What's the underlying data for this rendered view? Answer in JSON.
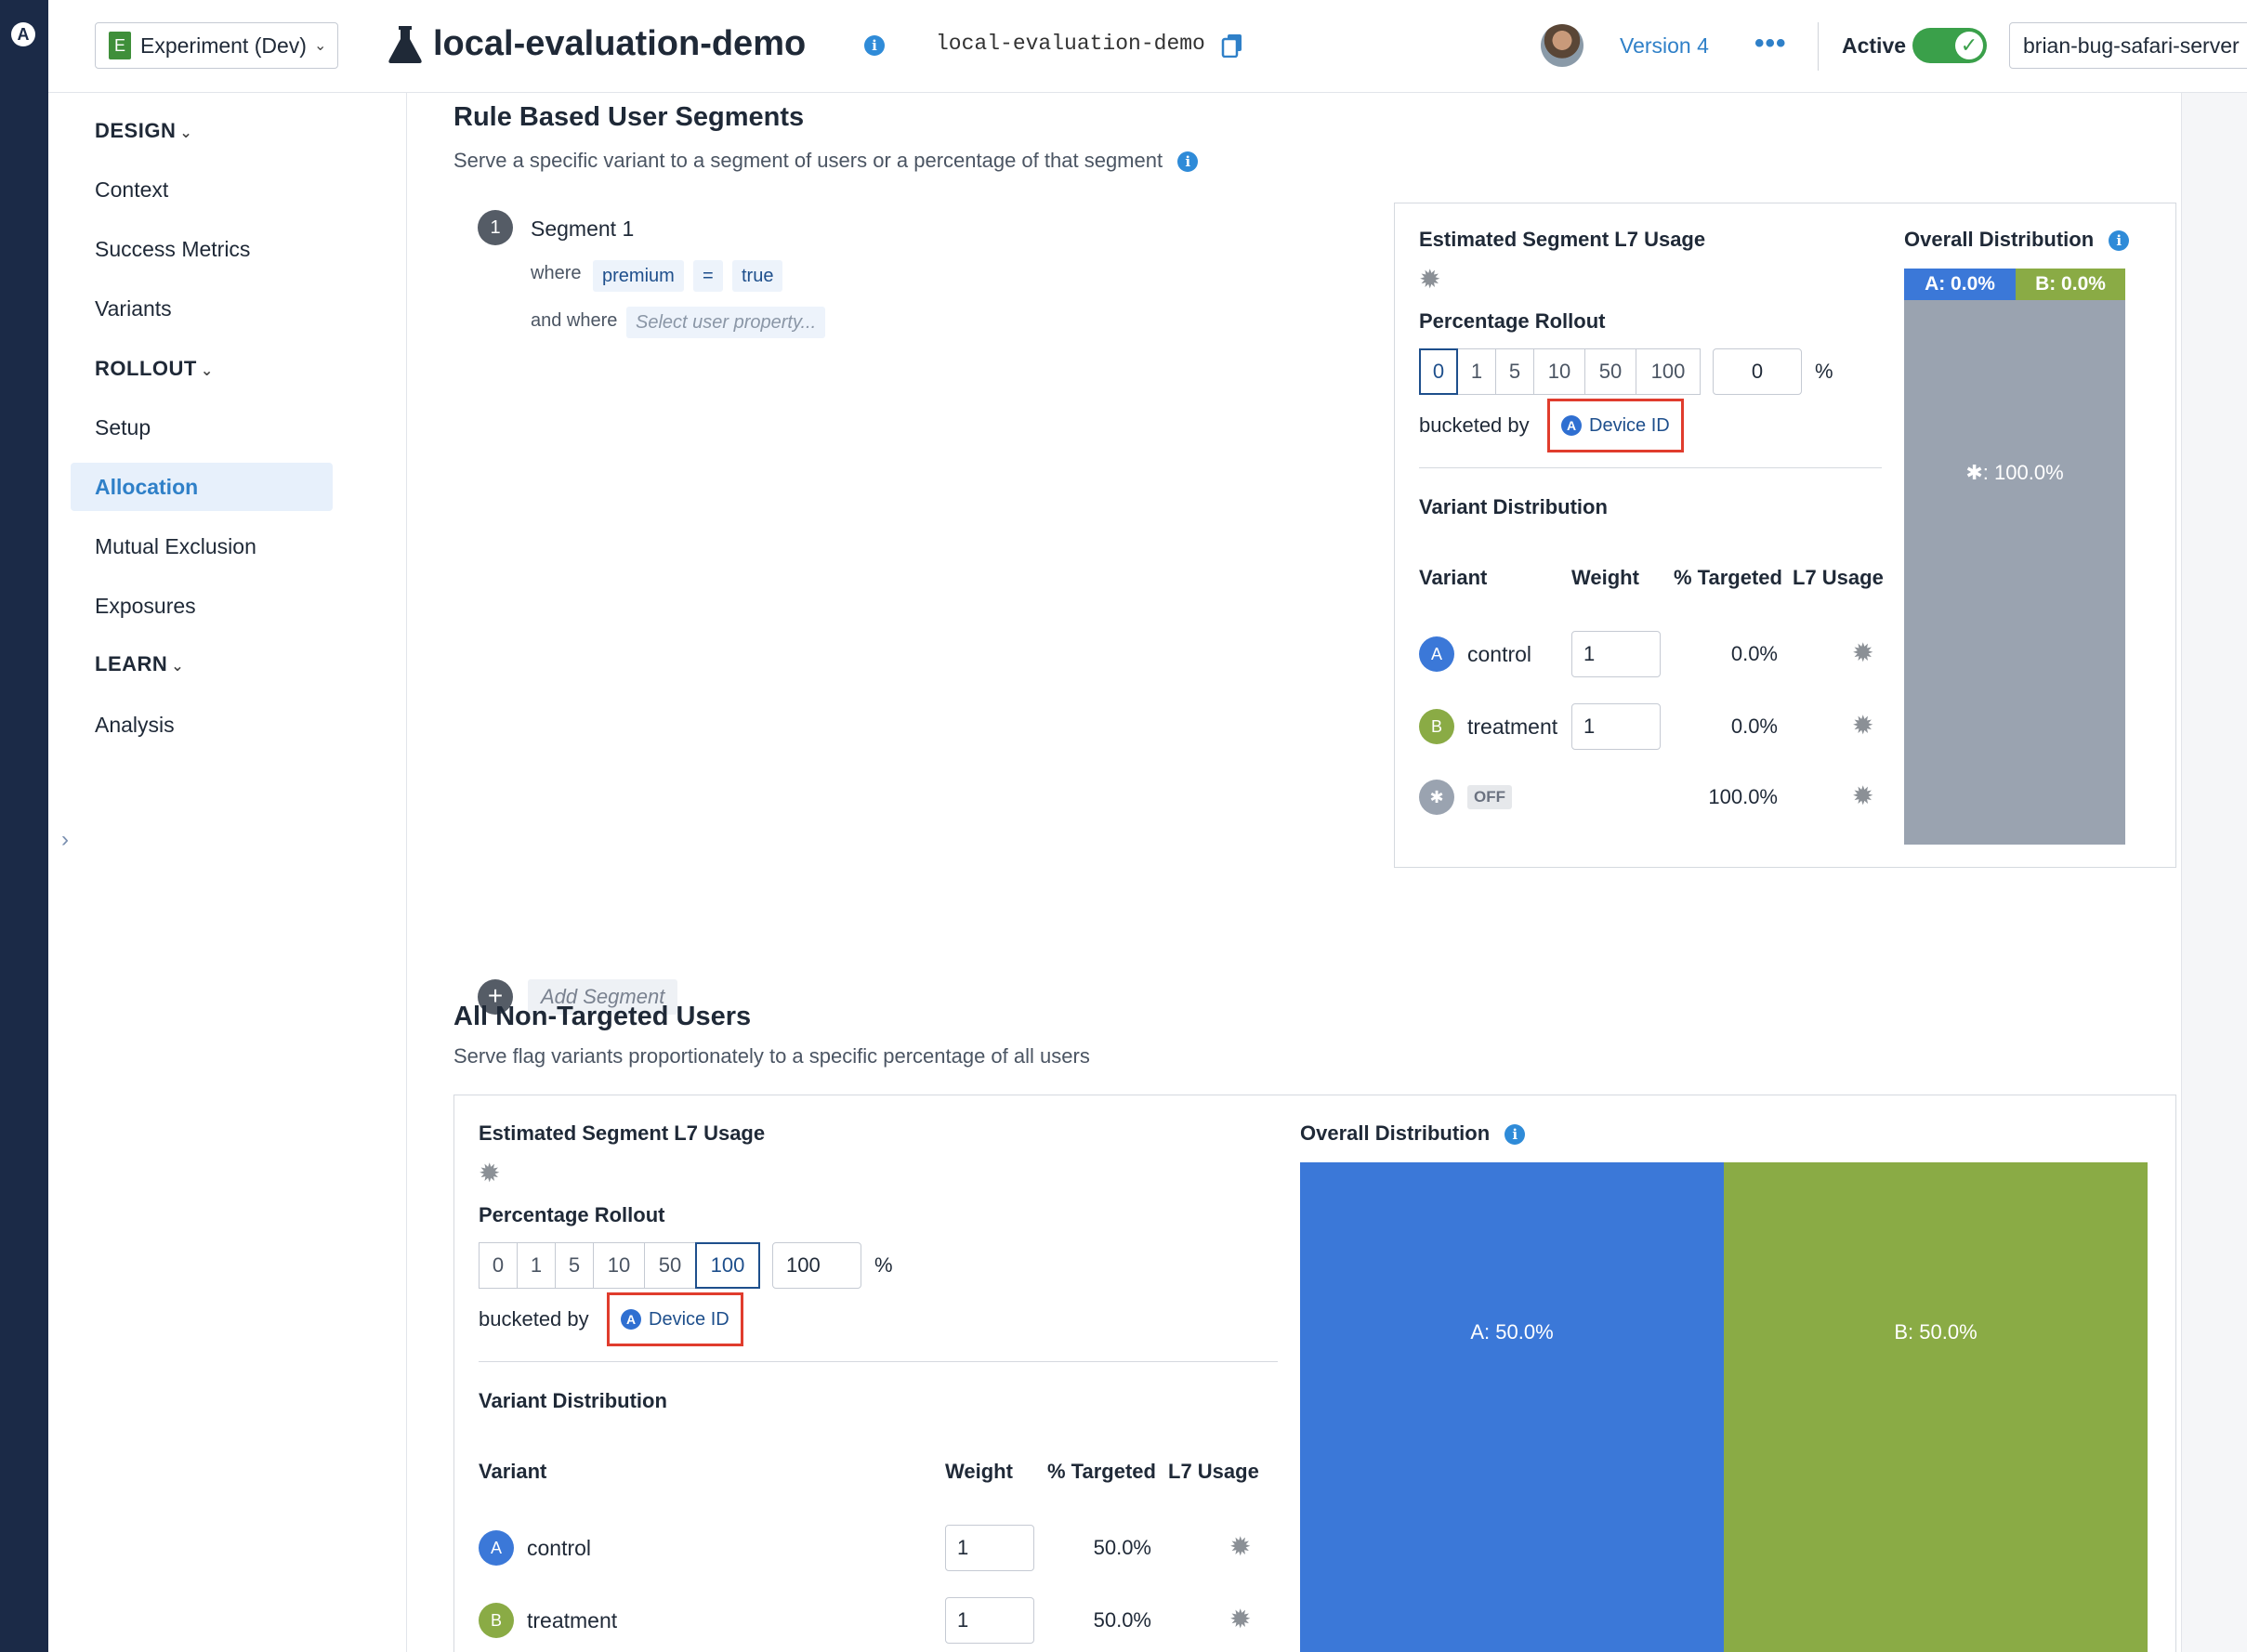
{
  "rail": {
    "logo": "A"
  },
  "header": {
    "environment": {
      "badge": "E",
      "label": "Experiment (Dev)"
    },
    "title": "local-evaluation-demo",
    "flag_key": "local-evaluation-demo",
    "version": "Version 4",
    "more": "•••",
    "status_label": "Active",
    "toggle_on": true,
    "deployment": "brian-bug-safari-server"
  },
  "sidebar": {
    "design_label": "DESIGN",
    "design_items": [
      "Context",
      "Success Metrics",
      "Variants"
    ],
    "rollout_label": "ROLLOUT",
    "rollout_items": [
      "Setup",
      "Allocation",
      "Mutual Exclusion",
      "Exposures"
    ],
    "learn_label": "LEARN",
    "learn_items": [
      "Analysis"
    ],
    "active_item": "Allocation",
    "collapse_glyph": "›"
  },
  "rule_segments": {
    "title": "Rule Based User Segments",
    "description": "Serve a specific variant to a segment of users or a percentage of that segment",
    "segment": {
      "number": "1",
      "name": "Segment 1",
      "where_label": "where",
      "property": "premium",
      "operator": "=",
      "value": "true",
      "and_where_label": "and where",
      "select_placeholder": "Select user property..."
    },
    "add_segment": "Add Segment",
    "panel": {
      "estimated_label": "Estimated Segment L7 Usage",
      "rollout_label": "Percentage Rollout",
      "rollout_options": [
        "0",
        "1",
        "5",
        "10",
        "50",
        "100"
      ],
      "rollout_selected": "0",
      "rollout_value": "0",
      "percent_sign": "%",
      "bucketed_label": "bucketed by",
      "bucket_by": "Device ID",
      "variant_distribution_label": "Variant Distribution",
      "columns": {
        "variant": "Variant",
        "weight": "Weight",
        "targeted": "% Targeted",
        "usage": "L7 Usage"
      },
      "rows": [
        {
          "badge": "A",
          "name": "control",
          "weight": "1",
          "targeted": "0.0%"
        },
        {
          "badge": "B",
          "name": "treatment",
          "weight": "1",
          "targeted": "0.0%"
        },
        {
          "badge": "✱",
          "name": "OFF",
          "weight": "",
          "targeted": "100.0%"
        }
      ],
      "overall_label": "Overall Distribution",
      "dist_a": "A: 0.0%",
      "dist_b": "B: 0.0%",
      "dist_off": "✱: 100.0%",
      "share": {
        "a": 0.0,
        "b": 0.0,
        "off": 1.0
      }
    }
  },
  "non_targeted": {
    "title": "All Non-Targeted Users",
    "description": "Serve flag variants proportionately to a specific percentage of all users",
    "panel": {
      "estimated_label": "Estimated Segment L7 Usage",
      "rollout_label": "Percentage Rollout",
      "rollout_options": [
        "0",
        "1",
        "5",
        "10",
        "50",
        "100"
      ],
      "rollout_selected": "100",
      "rollout_value": "100",
      "percent_sign": "%",
      "bucketed_label": "bucketed by",
      "bucket_by": "Device ID",
      "variant_distribution_label": "Variant Distribution",
      "columns": {
        "variant": "Variant",
        "weight": "Weight",
        "targeted": "% Targeted",
        "usage": "L7 Usage"
      },
      "rows": [
        {
          "badge": "A",
          "name": "control",
          "weight": "1",
          "targeted": "50.0%"
        },
        {
          "badge": "B",
          "name": "treatment",
          "weight": "1",
          "targeted": "50.0%"
        }
      ],
      "overall_label": "Overall Distribution",
      "dist_a": "A: 50.0%",
      "dist_b": "B: 50.0%",
      "share": {
        "a": 0.5,
        "b": 0.5
      }
    }
  },
  "colors": {
    "variant_a": "#3b78d8",
    "variant_b": "#8aab45",
    "off": "#9aa3b0",
    "accent": "#2f80c8",
    "highlight_box": "#e03c2d",
    "toggle": "#3aa04a"
  },
  "icons": {
    "info": "i",
    "gear": "✹",
    "plus": "+",
    "check": "✓",
    "amplitude": "A"
  }
}
